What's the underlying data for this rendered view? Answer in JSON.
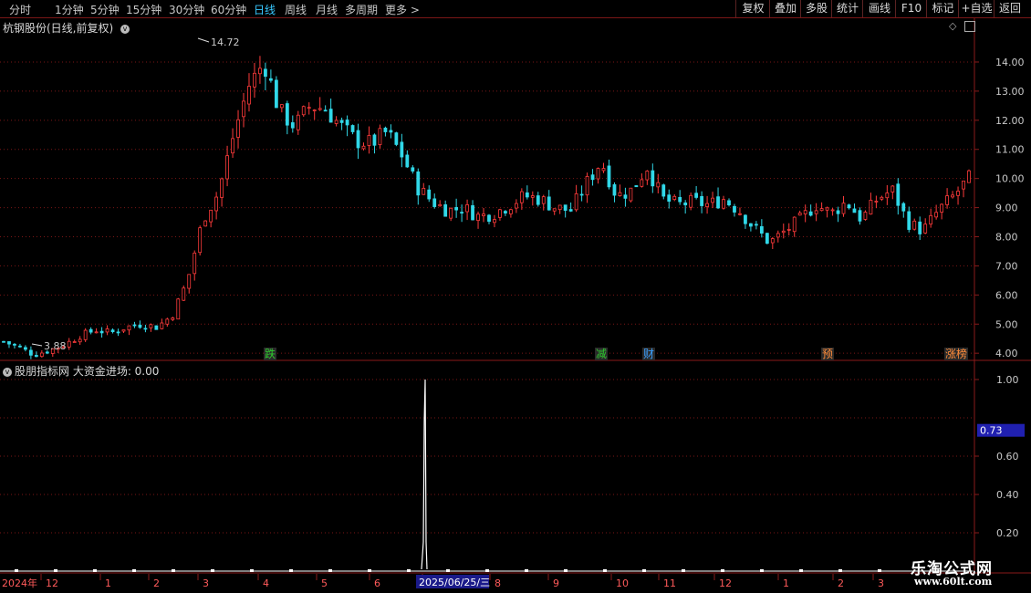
{
  "toolbar": {
    "periods": [
      "分时",
      "1分钟",
      "5分钟",
      "15分钟",
      "30分钟",
      "60分钟",
      "日线",
      "周线",
      "月线",
      "多周期",
      "更多 >"
    ],
    "active_period": "日线",
    "right_buttons": [
      "复权",
      "叠加",
      "多股",
      "统计",
      "画线",
      "F10",
      "标记",
      "+自选",
      "返回"
    ]
  },
  "main_panel": {
    "title": "杭钢股份(日线,前复权)",
    "high_label": "14.72",
    "low_label": "3.88",
    "y_ticks": [
      "14.00",
      "13.00",
      "12.00",
      "11.00",
      "10.00",
      "9.00",
      "8.00",
      "7.00",
      "6.00",
      "5.00",
      "4.00"
    ],
    "event_markers": [
      {
        "text": "跌",
        "color": "#2ecc2e"
      },
      {
        "text": "减",
        "color": "#2ecc2e"
      },
      {
        "text": "财",
        "color": "#3aa0ff"
      },
      {
        "text": "预",
        "color": "#ff8c3a"
      },
      {
        "text": "涨榜",
        "color": "#ff8c3a"
      }
    ]
  },
  "indicator_panel": {
    "title": "股朋指标网 大资金进场: 0.00",
    "y_ticks": [
      "1.00",
      "0.60",
      "0.40",
      "0.20"
    ],
    "current_value": "0.73"
  },
  "date_axis": {
    "year_label": "2024年",
    "month_labels": [
      "12",
      "1",
      "2",
      "3",
      "4",
      "5",
      "6",
      "7",
      "8",
      "9",
      "10",
      "11",
      "12",
      "1",
      "2",
      "3"
    ],
    "highlight_date": "2025/06/25/三"
  },
  "colors": {
    "up": "#ff3b3b",
    "down": "#30d8e8",
    "grid": "#7a1616",
    "highlight_bg": "#1a1a8a",
    "value_box": "#2020b0"
  },
  "chart_data": [
    {
      "type": "candlestick",
      "title": "杭钢股份(日线,前复权)",
      "ylim": [
        3.6,
        15.0
      ],
      "x": [
        "2024-12",
        "2025-01",
        "2025-02",
        "2025-03",
        "2025-04",
        "2025-05",
        "2025-06",
        "2025-07",
        "2025-08",
        "2025-09",
        "2025-10",
        "2025-11",
        "2025-12",
        "2026-01",
        "2026-02",
        "2026-03"
      ],
      "price_path": [
        4.4,
        4.2,
        3.95,
        4.1,
        4.3,
        4.6,
        4.8,
        4.7,
        4.9,
        5.0,
        4.9,
        5.3,
        6.5,
        8.6,
        9.5,
        11.5,
        13.2,
        14.0,
        12.3,
        11.8,
        12.5,
        12.4,
        11.8,
        11.3,
        11.2,
        11.6,
        10.8,
        9.7,
        9.2,
        8.9,
        9.0,
        8.7,
        8.8,
        9.1,
        9.4,
        9.3,
        9.0,
        8.9,
        9.8,
        10.6,
        9.4,
        9.6,
        10.4,
        9.3,
        9.1,
        9.2,
        9.1,
        9.3,
        8.9,
        8.3,
        7.8,
        8.2,
        8.6,
        9.1,
        8.8,
        9.2,
        8.6,
        9.3,
        9.6,
        8.5,
        8.2,
        8.9,
        9.4,
        10.0
      ],
      "high": 14.72,
      "low": 3.88
    },
    {
      "type": "line",
      "title": "股朋指标网 大资金进场",
      "ylim": [
        0,
        1.0
      ],
      "series": [
        {
          "values": [
            0,
            1.0,
            0
          ]
        }
      ],
      "current": 0.73
    }
  ]
}
